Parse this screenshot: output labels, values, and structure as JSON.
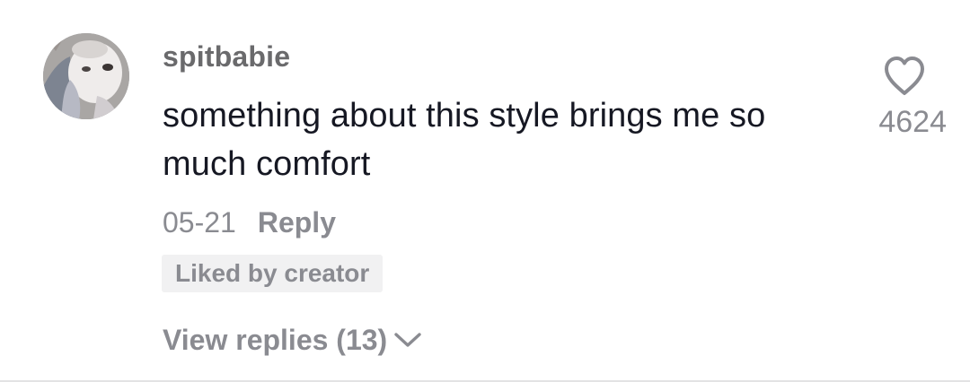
{
  "comment": {
    "username": "spitbabie",
    "text": "something about this style brings me so much comfort",
    "date": "05-21",
    "reply_label": "Reply",
    "liked_badge": "Liked by creator",
    "view_replies_label": "View replies (13)",
    "like_count": "4624"
  },
  "icons": {
    "avatar": "user-avatar",
    "like": "heart-outline-icon",
    "expand": "chevron-down-icon"
  },
  "colors": {
    "text_primary": "#161823",
    "text_secondary": "#8a8b91",
    "badge_background": "#f1f1f2"
  }
}
